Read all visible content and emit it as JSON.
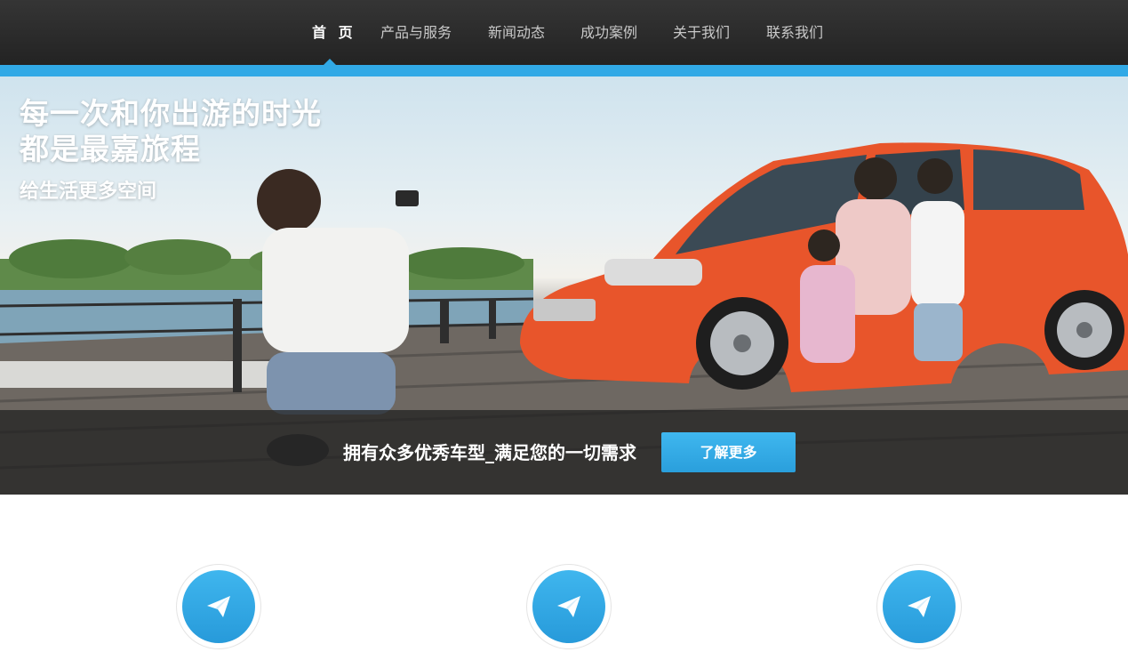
{
  "nav": {
    "items": [
      {
        "label": "首 页",
        "active": true
      },
      {
        "label": "产品与服务",
        "active": false
      },
      {
        "label": "新闻动态",
        "active": false
      },
      {
        "label": "成功案例",
        "active": false
      },
      {
        "label": "关于我们",
        "active": false
      },
      {
        "label": "联系我们",
        "active": false
      }
    ]
  },
  "hero": {
    "headline_line1": "每一次和你出游的时光",
    "headline_line2": "都是最嘉旅程",
    "subtitle": "给生活更多空间",
    "caption": "拥有众多优秀车型_满足您的一切需求",
    "button_label": "了解更多"
  },
  "features": [
    {
      "icon": "paper-plane-icon"
    },
    {
      "icon": "paper-plane-icon"
    },
    {
      "icon": "paper-plane-icon"
    }
  ],
  "colors": {
    "accent": "#31a9e6",
    "nav_background": "#2b2b2b",
    "car": "#e8552b"
  }
}
